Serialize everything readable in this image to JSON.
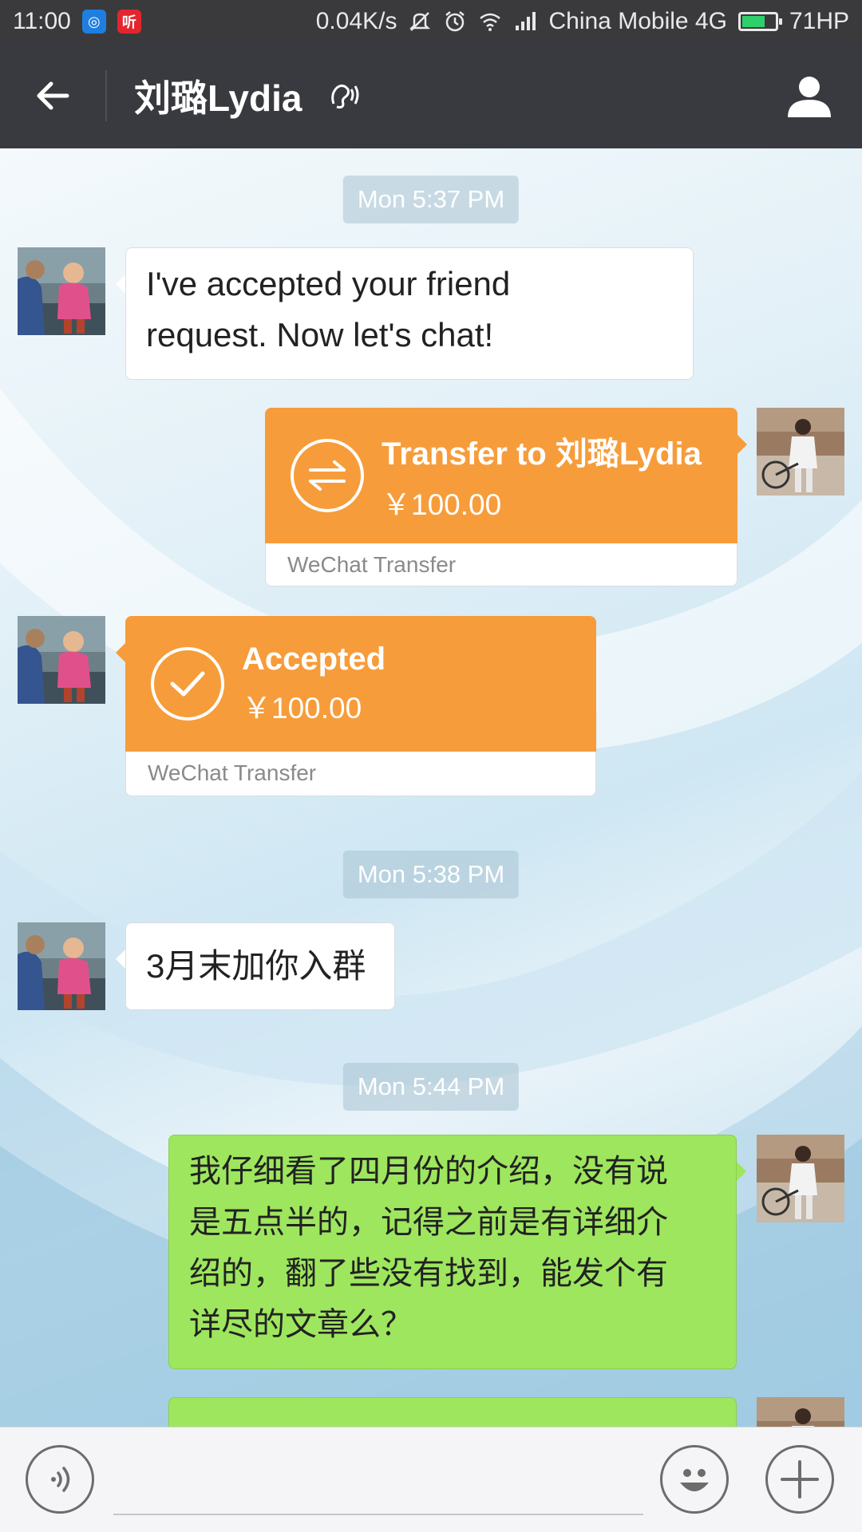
{
  "status_bar": {
    "time": "11:00",
    "speed": "0.04K/s",
    "carrier": "China Mobile",
    "network": "4G",
    "battery": "71HP",
    "battery_level": 0.71,
    "icons": [
      "alipay-app-icon",
      "listen-app-icon",
      "mute-icon",
      "alarm-icon",
      "wifi-icon",
      "signal-icon",
      "battery-icon"
    ]
  },
  "header": {
    "title": "刘璐Lydia"
  },
  "chat": {
    "messages": [
      {
        "type": "time",
        "text": "Mon 5:37 PM"
      },
      {
        "type": "text",
        "side": "left",
        "text_line1": "I've accepted your friend",
        "text_line2": "request. Now let's chat!"
      },
      {
        "type": "transfer",
        "side": "right",
        "title": "Transfer to 刘璐Lydia",
        "amount": "￥100.00",
        "footer": "WeChat Transfer"
      },
      {
        "type": "transfer",
        "side": "left",
        "title": "Accepted",
        "amount": "￥100.00",
        "footer": "WeChat Transfer"
      },
      {
        "type": "time",
        "text": "Mon 5:38 PM"
      },
      {
        "type": "text",
        "side": "left",
        "text": "3月末加你入群"
      },
      {
        "type": "time",
        "text": "Mon 5:44 PM"
      },
      {
        "type": "text",
        "side": "right",
        "lines": [
          "我仔细看了四月份的介绍，没有说",
          "是五点半的，记得之前是有详细介",
          "绍的，翻了些没有找到，能发个有",
          "详尽的文章么？"
        ]
      }
    ]
  },
  "colors": {
    "header_bg": "#393a3f",
    "transfer_orange": "#f79c3a",
    "sent_green": "#9ee65e"
  }
}
